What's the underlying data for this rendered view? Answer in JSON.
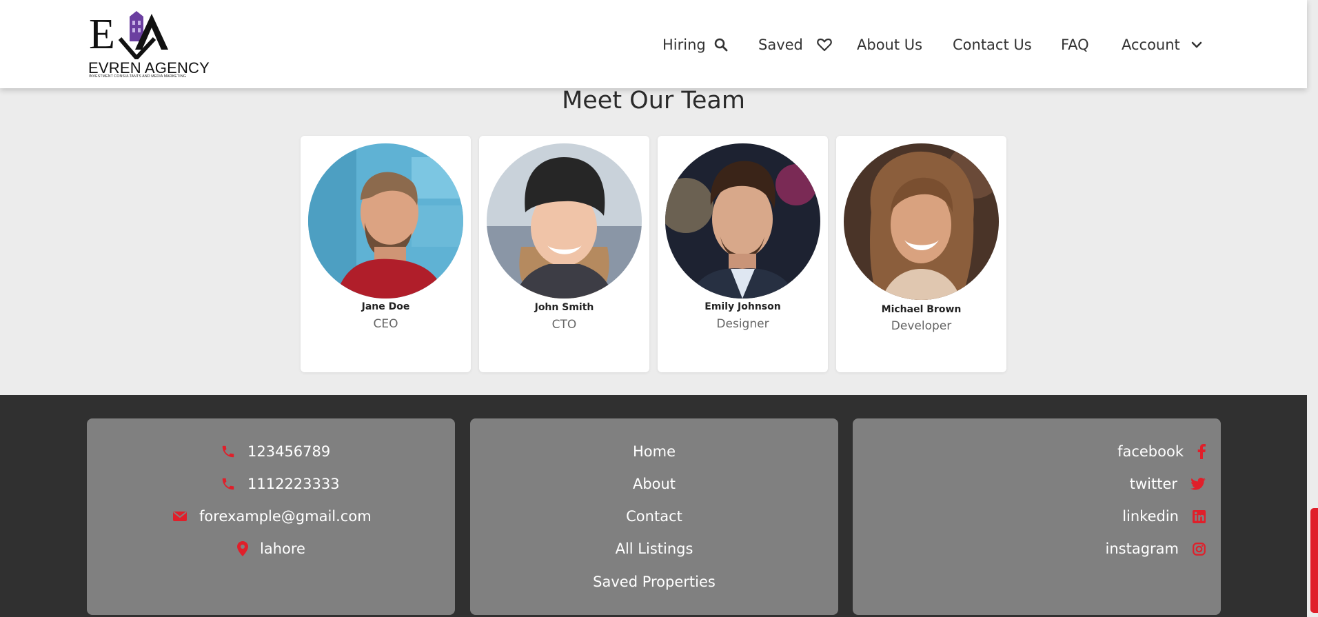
{
  "header": {
    "logo_letters": "EA",
    "logo_name": "EVREN AGENCY",
    "logo_tagline": "INVESTMENT CONSULTANTS AND MEDIA MARKETING",
    "nav": {
      "hiring": "Hiring",
      "saved": "Saved",
      "about": "About Us",
      "contact": "Contact Us",
      "faq": "FAQ",
      "account": "Account"
    }
  },
  "team": {
    "title": "Meet Our Team",
    "members": [
      {
        "name": "Jane Doe",
        "role": "CEO"
      },
      {
        "name": "John Smith",
        "role": "CTO"
      },
      {
        "name": "Emily Johnson",
        "role": "Designer"
      },
      {
        "name": "Michael Brown",
        "role": "Developer"
      }
    ]
  },
  "footer": {
    "contact": {
      "phone1": "123456789",
      "phone2": "1112223333",
      "email": "forexample@gmail.com",
      "location": "lahore"
    },
    "links": [
      "Home",
      "About",
      "Contact",
      "All Listings",
      "Saved Properties"
    ],
    "social": {
      "facebook": "facebook",
      "twitter": "twitter",
      "linkedin": "linkedin",
      "instagram": "instagram"
    }
  },
  "colors": {
    "accent": "#e01f2a",
    "footer_bg": "#303030",
    "footer_box": "#808080",
    "page_bg": "#ececec",
    "logo_purple": "#6b3fa0"
  }
}
